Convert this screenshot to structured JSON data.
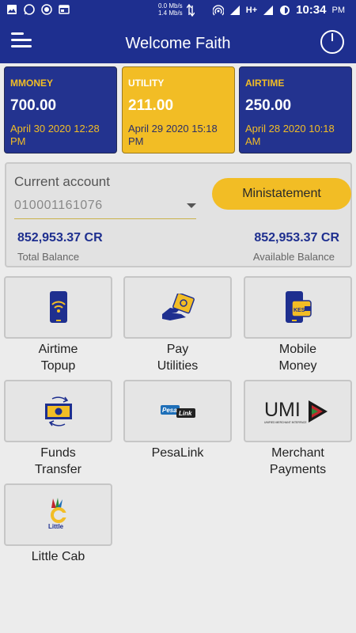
{
  "status_bar": {
    "net_speed_up": "0.0 Mb/s",
    "net_speed_down": "1.4 Mb/s",
    "signal": "H+",
    "time": "10:34",
    "ampm": "PM"
  },
  "header": {
    "title": "Welcome Faith"
  },
  "cards": [
    {
      "label": "MMONEY",
      "amount": "700.00",
      "date_line1": "April 30 2020 12:28",
      "date_line2": "PM"
    },
    {
      "label": "UTILITY",
      "amount": "211.00",
      "date_line1": "April 29 2020 15:18",
      "date_line2": "PM"
    },
    {
      "label": "AIRTIME",
      "amount": "250.00",
      "date_line1": "April 28 2020 10:18",
      "date_line2": "AM"
    }
  ],
  "account": {
    "title": "Current account",
    "number": "010001161076",
    "ministatement_label": "Ministatement",
    "total_balance_value": "852,953.37 CR",
    "total_balance_label": "Total Balance",
    "available_balance_value": "852,953.37 CR",
    "available_balance_label": "Available Balance"
  },
  "services": [
    {
      "line1": "Airtime",
      "line2": "Topup",
      "icon": "phone-wifi-icon"
    },
    {
      "line1": "Pay",
      "line2": "Utilities",
      "icon": "hand-bill-icon"
    },
    {
      "line1": "Mobile",
      "line2": "Money",
      "icon": "phone-wallet-icon"
    },
    {
      "line1": "Funds",
      "line2": "Transfer",
      "icon": "money-transfer-icon"
    },
    {
      "line1": "PesaLink",
      "line2": "",
      "icon": "pesalink-logo"
    },
    {
      "line1": "Merchant",
      "line2": "Payments",
      "icon": "umi-logo"
    },
    {
      "line1": "Little Cab",
      "line2": "",
      "icon": "little-logo"
    }
  ],
  "logos": {
    "pesalink_a": "Pesa",
    "pesalink_b": "Link",
    "umi": "UMI",
    "umi_sub": "UNIFIED MERCHANT INTERFACE",
    "little": "Little",
    "wallet_kes": "KES"
  },
  "colors": {
    "primary": "#1e2f8f",
    "accent": "#f2bd25",
    "background": "#ececec"
  }
}
